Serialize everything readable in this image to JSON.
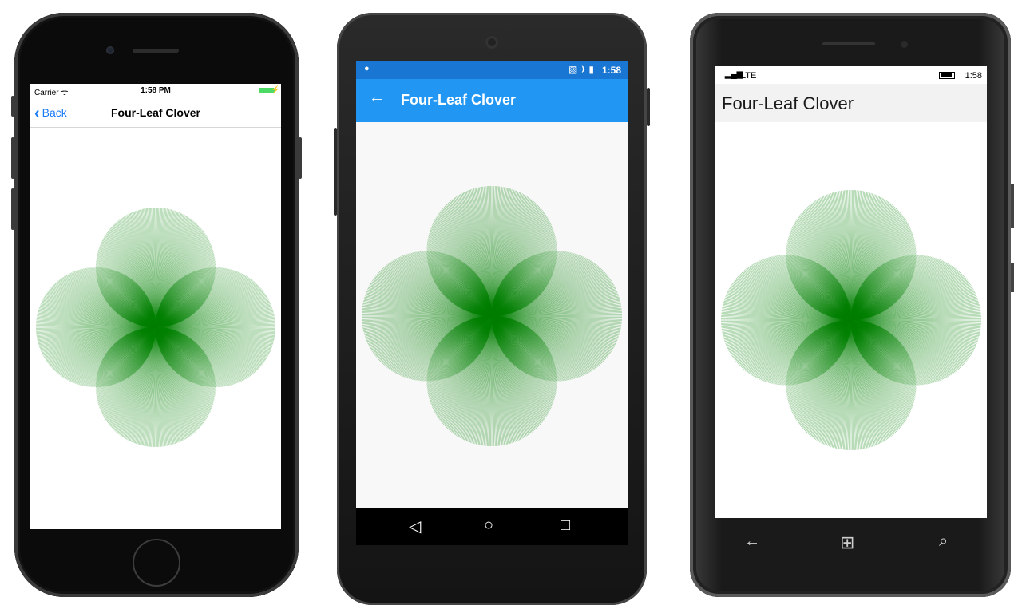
{
  "ios": {
    "carrier": "Carrier",
    "wifi": "ᯤ",
    "time": "1:58 PM",
    "back_label": "Back",
    "title": "Four-Leaf Clover"
  },
  "android": {
    "time": "1:58",
    "title": "Four-Leaf Clover",
    "back_arrow": "←",
    "nav_back": "◁",
    "nav_home": "○",
    "nav_recents": "□"
  },
  "windows": {
    "network": "LTE",
    "time": "1:58",
    "title": "Four-Leaf Clover",
    "nav_back": "←",
    "nav_start": "⊞",
    "nav_search": "⌕"
  },
  "clover": {
    "color": "#008000",
    "leaves": 4,
    "lines_per_leaf": 360
  }
}
